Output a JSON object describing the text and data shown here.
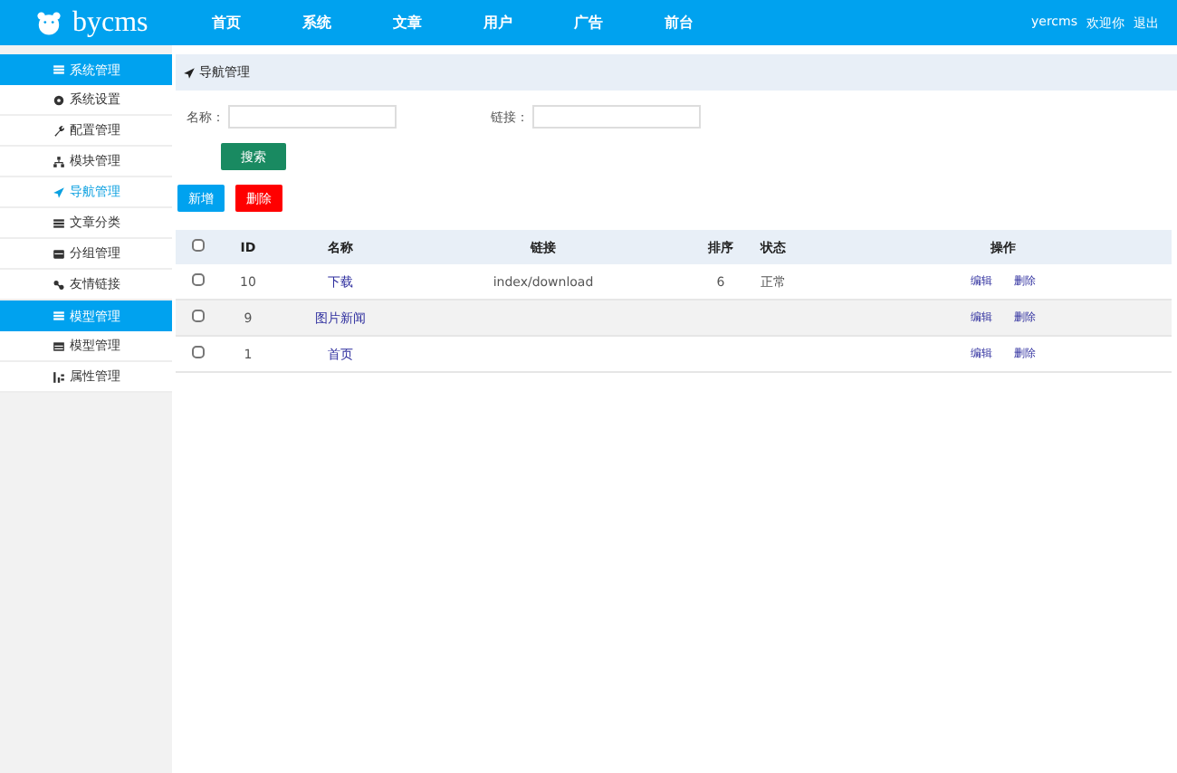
{
  "header": {
    "logo": "bycms",
    "nav": [
      "首页",
      "系统",
      "文章",
      "用户",
      "广告",
      "前台"
    ],
    "user": "yercms",
    "welcome": "欢迎你",
    "logout": "退出"
  },
  "sidebar": [
    {
      "kind": "section",
      "label": "系统管理"
    },
    {
      "kind": "item",
      "label": "系统设置",
      "selected": false
    },
    {
      "kind": "item",
      "label": "配置管理",
      "selected": false
    },
    {
      "kind": "item",
      "label": "模块管理",
      "selected": false
    },
    {
      "kind": "item",
      "label": "导航管理",
      "selected": true
    },
    {
      "kind": "item",
      "label": "文章分类",
      "selected": false
    },
    {
      "kind": "item",
      "label": "分组管理",
      "selected": false
    },
    {
      "kind": "item",
      "label": "友情链接",
      "selected": false
    },
    {
      "kind": "section",
      "label": "模型管理"
    },
    {
      "kind": "item",
      "label": "模型管理",
      "selected": false
    },
    {
      "kind": "item",
      "label": "属性管理",
      "selected": false
    }
  ],
  "breadcrumb": "导航管理",
  "filters": [
    {
      "label": "名称："
    },
    {
      "label": "链接："
    }
  ],
  "search_button": "搜索",
  "add_button": "新增",
  "delete_button": "删除",
  "table": {
    "all_checked": false,
    "columns": [
      "ID",
      "名称",
      "链接",
      "排序",
      "状态",
      "操作"
    ],
    "rows": [
      {
        "checked": false,
        "id": "10",
        "name": "下载",
        "link": "index/download",
        "sort": "6",
        "status": "正常",
        "actions": [
          "编辑",
          "删除"
        ]
      },
      {
        "checked": false,
        "id": "9",
        "name": "图片新闻",
        "actions": [
          "编辑",
          "删除"
        ]
      },
      {
        "checked": false,
        "id": "1",
        "name": "首页",
        "actions": [
          "编辑",
          "删除"
        ]
      }
    ]
  }
}
